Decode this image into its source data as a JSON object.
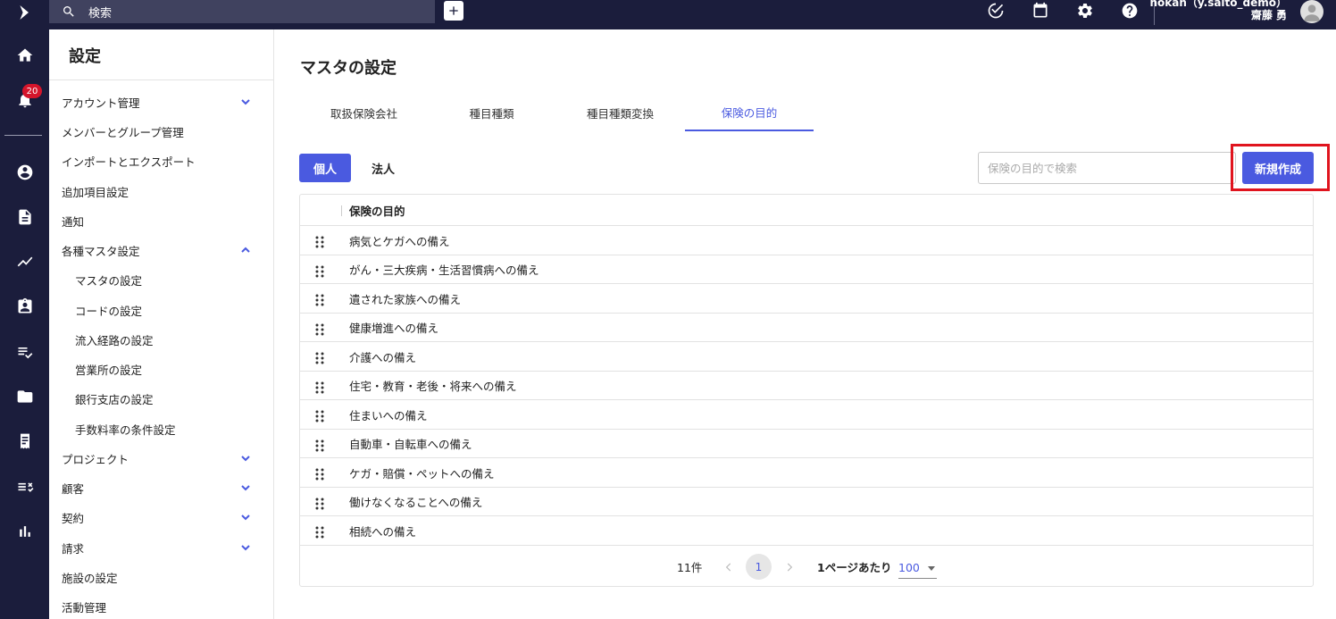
{
  "topbar": {
    "search_label": "検索"
  },
  "user": {
    "line1": "hokan（y.saito_demo）",
    "line2": "齋藤 勇"
  },
  "notifications": {
    "count": "20"
  },
  "sidebar": {
    "title": "設定",
    "items": [
      {
        "label": "アカウント管理",
        "chevron": "down"
      },
      {
        "label": "メンバーとグループ管理"
      },
      {
        "label": "インポートとエクスポート"
      },
      {
        "label": "追加項目設定"
      },
      {
        "label": "通知"
      },
      {
        "label": "各種マスタ設定",
        "chevron": "up"
      },
      {
        "label": "マスタの設定",
        "sub": true
      },
      {
        "label": "コードの設定",
        "sub": true
      },
      {
        "label": "流入経路の設定",
        "sub": true
      },
      {
        "label": "営業所の設定",
        "sub": true
      },
      {
        "label": "銀行支店の設定",
        "sub": true
      },
      {
        "label": "手数料率の条件設定",
        "sub": true
      },
      {
        "label": "プロジェクト",
        "chevron": "down"
      },
      {
        "label": "顧客",
        "chevron": "down"
      },
      {
        "label": "契約",
        "chevron": "down"
      },
      {
        "label": "請求",
        "chevron": "down"
      },
      {
        "label": "施設の設定"
      },
      {
        "label": "活動管理"
      }
    ]
  },
  "main": {
    "title": "マスタの設定",
    "tabs": [
      {
        "label": "取扱保険会社"
      },
      {
        "label": "種目種類"
      },
      {
        "label": "種目種類変換"
      },
      {
        "label": "保険の目的",
        "active": true
      }
    ],
    "segment": {
      "on_label": "個人",
      "off_label": "法人"
    },
    "search": {
      "placeholder": "保険の目的で検索",
      "value": ""
    },
    "new_button": "新規作成",
    "table": {
      "header": "保険の目的",
      "rows": [
        "病気とケガへの備え",
        "がん・三大疾病・生活習慣病への備え",
        "遺された家族への備え",
        "健康増進への備え",
        "介護への備え",
        "住宅・教育・老後・将来への備え",
        "住まいへの備え",
        "自動車・自転車への備え",
        "ケガ・賠償・ペットへの備え",
        "働けなくなることへの備え",
        "相続への備え"
      ]
    },
    "pager": {
      "count": "11件",
      "current_page": "1",
      "per_page_label": "1ページあたり",
      "per_page_value": "100"
    }
  },
  "colors": {
    "nav_bg": "#1b1d3c",
    "accent": "#4a5ae0",
    "highlight": "#e0141e",
    "badge": "#d5152b"
  }
}
